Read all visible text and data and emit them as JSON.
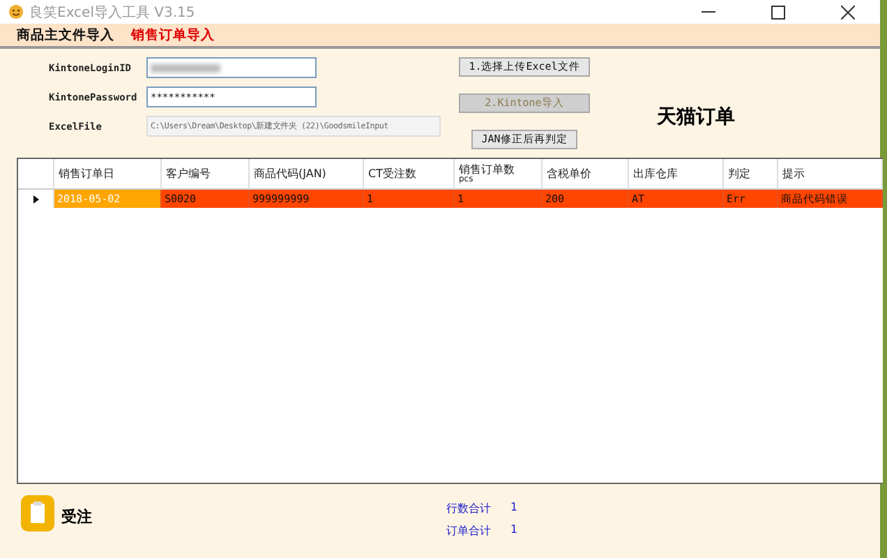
{
  "window": {
    "title": "良笑Excel导入工具 V3.15"
  },
  "menu": [
    {
      "label": "商品主文件导入",
      "selected": false
    },
    {
      "label": "销售订单导入",
      "selected": true
    }
  ],
  "form": {
    "fields": [
      {
        "label": "KintoneLoginID",
        "redacted": true,
        "disabled": false
      },
      {
        "label": "KintonePassword",
        "value": "***********",
        "redacted": false,
        "disabled": false
      },
      {
        "label": "ExcelFile",
        "value": "C:\\Users\\Dream\\Desktop\\新建文件夹 (22)\\GoodsmileInput",
        "redacted": false,
        "disabled": true
      }
    ],
    "buttons": [
      {
        "label": "1.选择上传Excel文件",
        "disabled": false
      },
      {
        "label": "2.Kintone导入",
        "disabled": true
      },
      {
        "label": "JAN修正后再判定",
        "disabled": false
      }
    ],
    "heading": "天猫订单"
  },
  "table": {
    "columns": [
      "销售订单日",
      "客户编号",
      "商品代码(JAN)",
      "CT受注数",
      "销售订单数",
      "含税单价",
      "出库仓库",
      "判定",
      "提示"
    ],
    "column_5_sub": "pcs",
    "rows": [
      {
        "current": true,
        "error": true,
        "cells": [
          "2018-05-02",
          "S0020",
          "999999999",
          "1",
          "1",
          "200",
          "AT",
          "Err",
          "商品代码错误"
        ]
      }
    ]
  },
  "footer": {
    "app_label": "受注",
    "totals": [
      {
        "label": "行数合计",
        "value": "1"
      },
      {
        "label": "订单合计",
        "value": "1"
      }
    ]
  }
}
